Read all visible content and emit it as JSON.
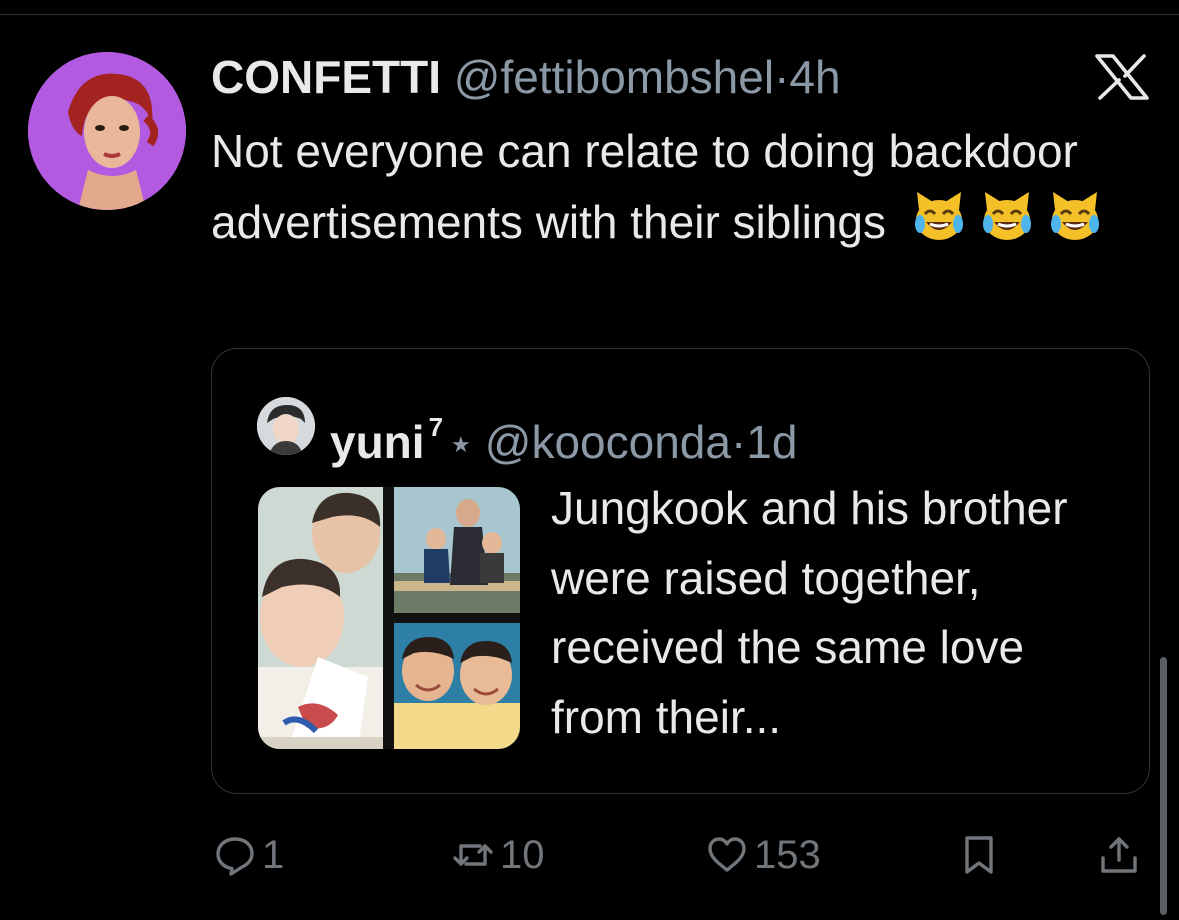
{
  "tweet": {
    "author_name": "CONFETTI",
    "handle": "@fettibombshel",
    "separator": "·",
    "time": "4h",
    "text": "Not everyone can relate to doing backdoor advertisements with their siblings",
    "emoji": [
      "cat-tears-of-joy",
      "cat-tears-of-joy",
      "cat-tears-of-joy"
    ]
  },
  "quote": {
    "author_name": "yuni",
    "name_badge": "7",
    "name_symbol": "★",
    "handle": "@kooconda",
    "separator": "·",
    "time": "1d",
    "text": "Jungkook and his brother were raised together, received the same love from their..."
  },
  "actions": {
    "replies": "1",
    "retweets": "10",
    "likes": "153"
  },
  "icons": {
    "brand": "x-logo-icon",
    "reply": "reply-icon",
    "retweet": "retweet-icon",
    "like": "heart-icon",
    "bookmark": "bookmark-icon",
    "share": "share-icon"
  },
  "colors": {
    "background": "#000000",
    "text_primary": "#e7e9ea",
    "text_secondary": "#8b98a5",
    "icon_gray": "#71767b",
    "border": "#2f3336",
    "avatar_bg": "#b25be0"
  }
}
